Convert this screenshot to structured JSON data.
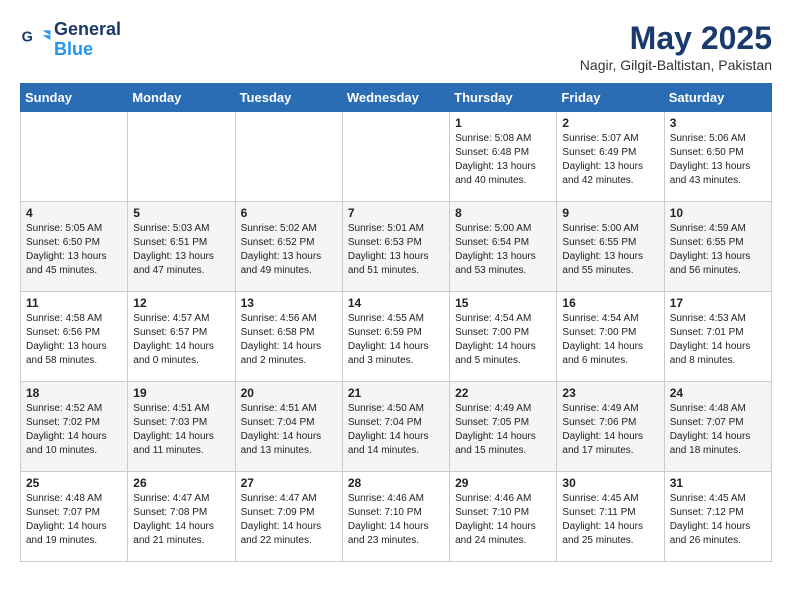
{
  "header": {
    "logo_line1": "General",
    "logo_line2": "Blue",
    "month_year": "May 2025",
    "location": "Nagir, Gilgit-Baltistan, Pakistan"
  },
  "weekdays": [
    "Sunday",
    "Monday",
    "Tuesday",
    "Wednesday",
    "Thursday",
    "Friday",
    "Saturday"
  ],
  "weeks": [
    [
      {
        "day": "",
        "info": ""
      },
      {
        "day": "",
        "info": ""
      },
      {
        "day": "",
        "info": ""
      },
      {
        "day": "",
        "info": ""
      },
      {
        "day": "1",
        "info": "Sunrise: 5:08 AM\nSunset: 6:48 PM\nDaylight: 13 hours\nand 40 minutes."
      },
      {
        "day": "2",
        "info": "Sunrise: 5:07 AM\nSunset: 6:49 PM\nDaylight: 13 hours\nand 42 minutes."
      },
      {
        "day": "3",
        "info": "Sunrise: 5:06 AM\nSunset: 6:50 PM\nDaylight: 13 hours\nand 43 minutes."
      }
    ],
    [
      {
        "day": "4",
        "info": "Sunrise: 5:05 AM\nSunset: 6:50 PM\nDaylight: 13 hours\nand 45 minutes."
      },
      {
        "day": "5",
        "info": "Sunrise: 5:03 AM\nSunset: 6:51 PM\nDaylight: 13 hours\nand 47 minutes."
      },
      {
        "day": "6",
        "info": "Sunrise: 5:02 AM\nSunset: 6:52 PM\nDaylight: 13 hours\nand 49 minutes."
      },
      {
        "day": "7",
        "info": "Sunrise: 5:01 AM\nSunset: 6:53 PM\nDaylight: 13 hours\nand 51 minutes."
      },
      {
        "day": "8",
        "info": "Sunrise: 5:00 AM\nSunset: 6:54 PM\nDaylight: 13 hours\nand 53 minutes."
      },
      {
        "day": "9",
        "info": "Sunrise: 5:00 AM\nSunset: 6:55 PM\nDaylight: 13 hours\nand 55 minutes."
      },
      {
        "day": "10",
        "info": "Sunrise: 4:59 AM\nSunset: 6:55 PM\nDaylight: 13 hours\nand 56 minutes."
      }
    ],
    [
      {
        "day": "11",
        "info": "Sunrise: 4:58 AM\nSunset: 6:56 PM\nDaylight: 13 hours\nand 58 minutes."
      },
      {
        "day": "12",
        "info": "Sunrise: 4:57 AM\nSunset: 6:57 PM\nDaylight: 14 hours\nand 0 minutes."
      },
      {
        "day": "13",
        "info": "Sunrise: 4:56 AM\nSunset: 6:58 PM\nDaylight: 14 hours\nand 2 minutes."
      },
      {
        "day": "14",
        "info": "Sunrise: 4:55 AM\nSunset: 6:59 PM\nDaylight: 14 hours\nand 3 minutes."
      },
      {
        "day": "15",
        "info": "Sunrise: 4:54 AM\nSunset: 7:00 PM\nDaylight: 14 hours\nand 5 minutes."
      },
      {
        "day": "16",
        "info": "Sunrise: 4:54 AM\nSunset: 7:00 PM\nDaylight: 14 hours\nand 6 minutes."
      },
      {
        "day": "17",
        "info": "Sunrise: 4:53 AM\nSunset: 7:01 PM\nDaylight: 14 hours\nand 8 minutes."
      }
    ],
    [
      {
        "day": "18",
        "info": "Sunrise: 4:52 AM\nSunset: 7:02 PM\nDaylight: 14 hours\nand 10 minutes."
      },
      {
        "day": "19",
        "info": "Sunrise: 4:51 AM\nSunset: 7:03 PM\nDaylight: 14 hours\nand 11 minutes."
      },
      {
        "day": "20",
        "info": "Sunrise: 4:51 AM\nSunset: 7:04 PM\nDaylight: 14 hours\nand 13 minutes."
      },
      {
        "day": "21",
        "info": "Sunrise: 4:50 AM\nSunset: 7:04 PM\nDaylight: 14 hours\nand 14 minutes."
      },
      {
        "day": "22",
        "info": "Sunrise: 4:49 AM\nSunset: 7:05 PM\nDaylight: 14 hours\nand 15 minutes."
      },
      {
        "day": "23",
        "info": "Sunrise: 4:49 AM\nSunset: 7:06 PM\nDaylight: 14 hours\nand 17 minutes."
      },
      {
        "day": "24",
        "info": "Sunrise: 4:48 AM\nSunset: 7:07 PM\nDaylight: 14 hours\nand 18 minutes."
      }
    ],
    [
      {
        "day": "25",
        "info": "Sunrise: 4:48 AM\nSunset: 7:07 PM\nDaylight: 14 hours\nand 19 minutes."
      },
      {
        "day": "26",
        "info": "Sunrise: 4:47 AM\nSunset: 7:08 PM\nDaylight: 14 hours\nand 21 minutes."
      },
      {
        "day": "27",
        "info": "Sunrise: 4:47 AM\nSunset: 7:09 PM\nDaylight: 14 hours\nand 22 minutes."
      },
      {
        "day": "28",
        "info": "Sunrise: 4:46 AM\nSunset: 7:10 PM\nDaylight: 14 hours\nand 23 minutes."
      },
      {
        "day": "29",
        "info": "Sunrise: 4:46 AM\nSunset: 7:10 PM\nDaylight: 14 hours\nand 24 minutes."
      },
      {
        "day": "30",
        "info": "Sunrise: 4:45 AM\nSunset: 7:11 PM\nDaylight: 14 hours\nand 25 minutes."
      },
      {
        "day": "31",
        "info": "Sunrise: 4:45 AM\nSunset: 7:12 PM\nDaylight: 14 hours\nand 26 minutes."
      }
    ]
  ]
}
